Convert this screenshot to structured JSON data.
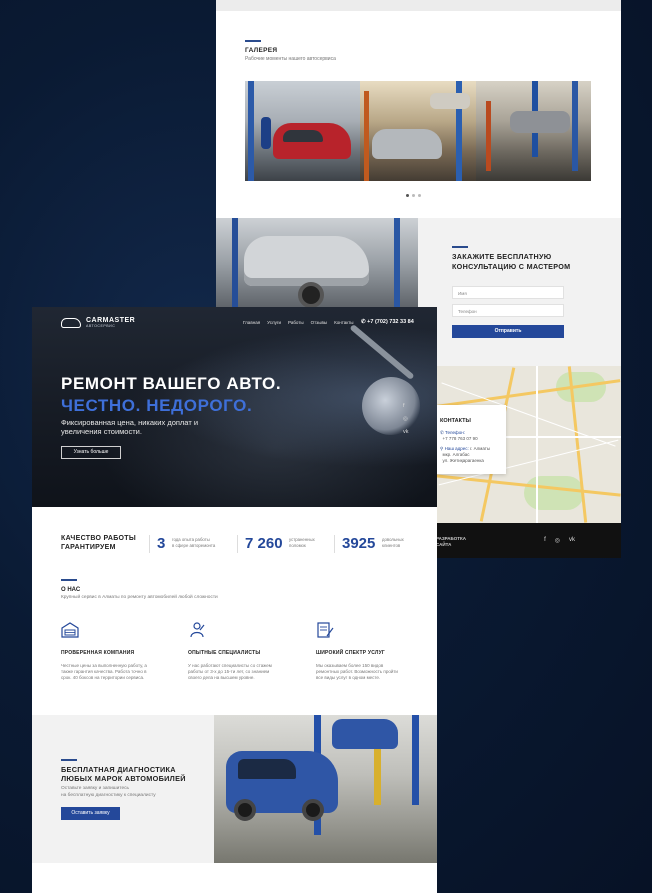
{
  "gallery": {
    "title": "ГАЛЕРЕЯ",
    "subtitle": "Рабочие моменты нашего автосервиса"
  },
  "consult": {
    "title": "ЗАКАЖИТЕ БЕСПЛАТНУЮ КОНСУЛЬТАЦИЮ С МАСТЕРОМ",
    "name_placeholder": "Имя",
    "phone_placeholder": "Телефон",
    "submit_label": "Отправить"
  },
  "contacts": {
    "title": "КОНТАКТЫ",
    "phone_label": "Телефон:",
    "phone": "+7 778 763 07 90",
    "address_label": "Наш адрес:",
    "address_city": "г. Алматы",
    "address_line1": "мкр. Алгабас",
    "address_line2": "ул. Жетиқарагаенка"
  },
  "back_footer": {
    "text_line1": "РАЗРАБОТКА",
    "text_line2": "САЙТА"
  },
  "header": {
    "logo_name": "CARMASTER",
    "logo_sub": "АВТОСЕРВИС",
    "nav": [
      "Главная",
      "Услуги",
      "Работы",
      "Отзывы",
      "Контакты"
    ],
    "phone": "+7 (702) 732 33 84"
  },
  "hero": {
    "title_line1": "РЕМОНТ ВАШЕГО АВТО.",
    "title_line2": "ЧЕСТНО. НЕДОРОГО.",
    "subtitle": "Фиксированная цена, никаких доплат и увеличения стоимости.",
    "button_label": "Узнать больше",
    "social": [
      "f",
      "◎",
      "vk"
    ]
  },
  "stats": {
    "title_line1": "КАЧЕСТВО РАБОТЫ",
    "title_line2": "ГАРАНТИРУЕМ",
    "items": [
      {
        "value": "3",
        "label_line1": "года опыта работы",
        "label_line2": "в сфере авторемонта"
      },
      {
        "value": "7 260",
        "label_line1": "устраненных",
        "label_line2": "поломок"
      },
      {
        "value": "3925",
        "label_line1": "довольных",
        "label_line2": "клиентов"
      }
    ]
  },
  "about": {
    "title": "О НАС",
    "subtitle": "Крупный сервис в Алматы по ремонту автомобилей любой сложности",
    "features": [
      {
        "icon": "garage-icon",
        "title": "ПРОВЕРЕННАЯ КОМПАНИЯ",
        "text": "Честные цены за выполненную работу, а также гарантия качества. Работа точно в срок. 40 боксов на территории сервиса."
      },
      {
        "icon": "mechanic-icon",
        "title": "ОПЫТНЫЕ СПЕЦИАЛИСТЫ",
        "text": "У нас работают специалисты со стажем работы от 3-х до 15-ти лет, со знанием своего дела на высшем уровне."
      },
      {
        "icon": "document-icon",
        "title": "ШИРОКИЙ СПЕКТР УСЛУГ",
        "text": "Мы оказываем более 150 видов ремонтных работ. Возможность пройти все виды услуг в одном месте."
      }
    ]
  },
  "diagnostics": {
    "title_line1": "БЕСПЛАТНАЯ ДИАГНОСТИКА",
    "title_line2": "ЛЮБЫХ МАРОК АВТОМОБИЛЕЙ",
    "subtitle_line1": "Оставьте заявку и запишитесь",
    "subtitle_line2": "на бесплатную диагностику к специалисту",
    "button_label": "Оставить заявку"
  },
  "colors": {
    "accent": "#24489a",
    "hero_blue_text": "#3e6fd9",
    "page_background": "#0a1a33"
  }
}
